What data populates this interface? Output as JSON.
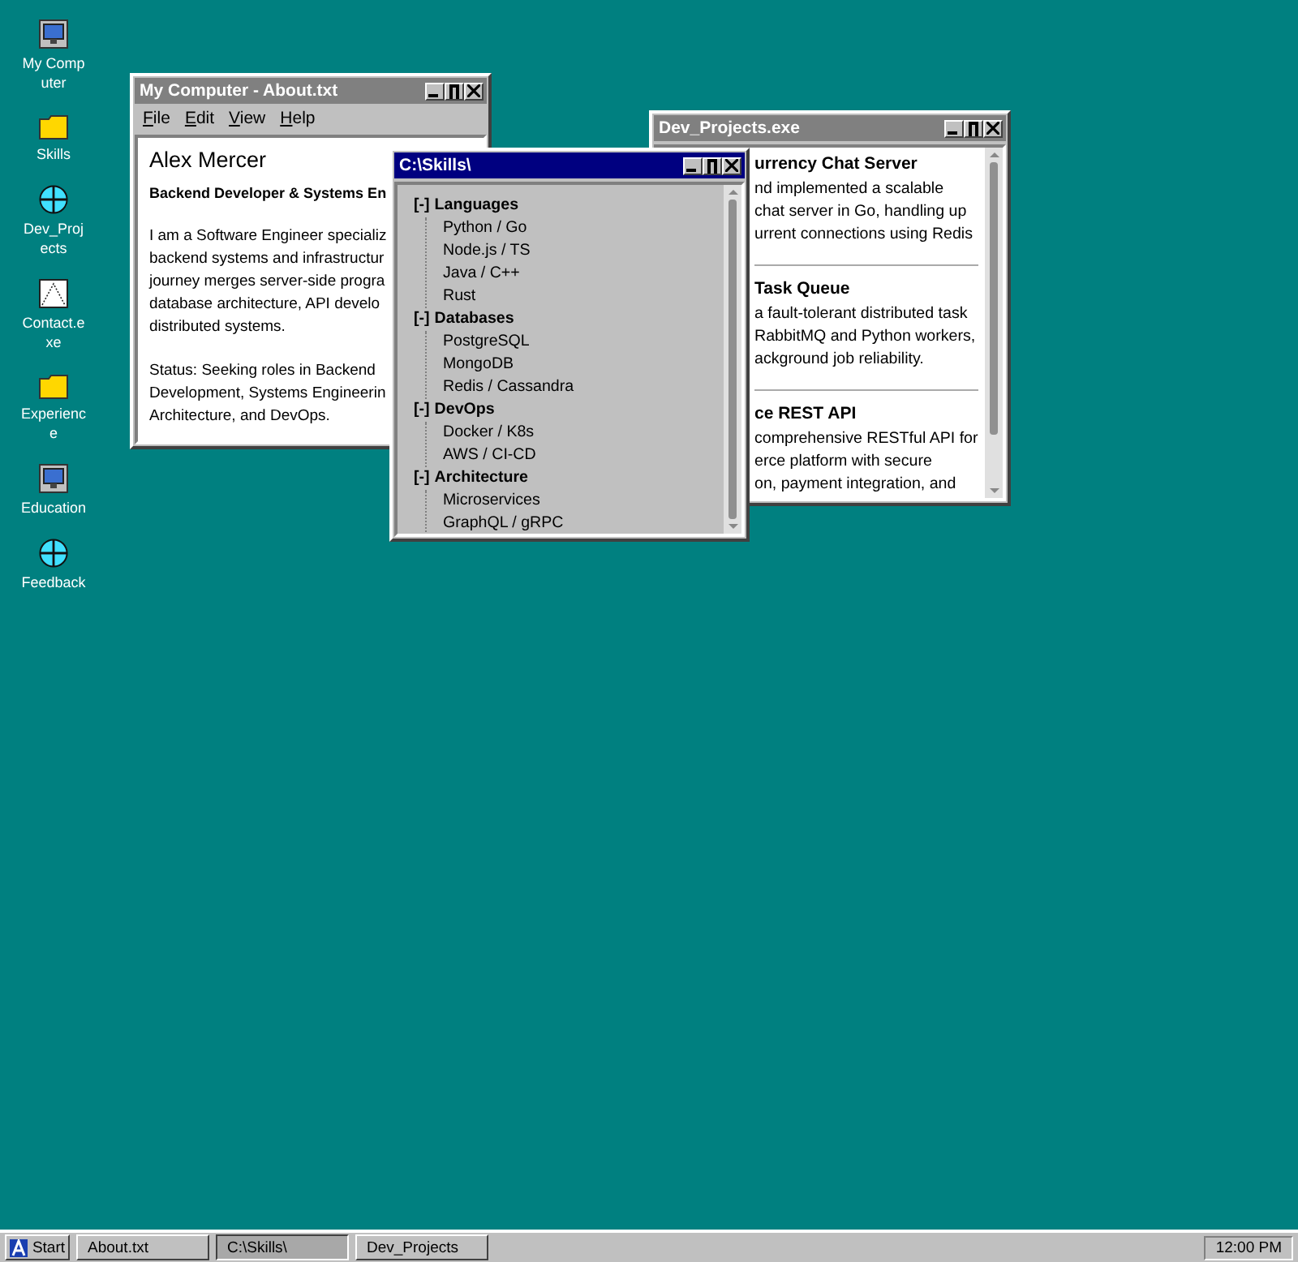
{
  "desktop_icons": [
    {
      "label": "My Computer",
      "kind": "computer"
    },
    {
      "label": "Skills",
      "kind": "folder"
    },
    {
      "label": "Dev_Projects",
      "kind": "globe"
    },
    {
      "label": "Contact.exe",
      "kind": "document"
    },
    {
      "label": "Experience",
      "kind": "folder"
    },
    {
      "label": "Education",
      "kind": "computer"
    },
    {
      "label": "Feedback",
      "kind": "globe"
    }
  ],
  "about_window": {
    "title": "My Computer - About.txt",
    "active": false,
    "menu": [
      "File",
      "Edit",
      "View",
      "Help"
    ],
    "name": "Alex Mercer",
    "subtitle": "Backend Developer & Systems En",
    "paragraphs": [
      [
        "I am a Software Engineer specializ",
        "backend systems and infrastructur",
        "journey merges server-side progra",
        "database architecture, API develo",
        "distributed systems."
      ],
      [
        "Status: Seeking roles in Backend",
        "Development, Systems Engineerin",
        "Architecture, and DevOps."
      ]
    ]
  },
  "projects_window": {
    "title": "Dev_Projects.exe",
    "active": false,
    "projects": [
      {
        "title": "urrency Chat Server",
        "lines": [
          "nd implemented a scalable",
          "chat server in Go, handling up",
          "urrent connections using Redis"
        ]
      },
      {
        "title": "Task Queue",
        "lines": [
          "a fault-tolerant distributed task",
          "RabbitMQ and Python workers,",
          "ackground job reliability."
        ]
      },
      {
        "title": "ce REST API",
        "lines": [
          "comprehensive RESTful API for",
          "erce platform with secure",
          "on, payment integration, and"
        ]
      }
    ]
  },
  "skills_window": {
    "title": "C:\\Skills\\",
    "active": true,
    "groups": [
      {
        "toggle": "[-]",
        "label": "Languages",
        "children": [
          {
            "label": "Python / Go"
          },
          {
            "label": "Node.js / TS"
          },
          {
            "label": "Java / C++"
          },
          {
            "label": "Rust"
          }
        ]
      },
      {
        "toggle": "[-]",
        "label": "Databases",
        "children": [
          {
            "label": "PostgreSQL"
          },
          {
            "label": "MongoDB"
          },
          {
            "label": "Redis / Cassandra"
          }
        ]
      },
      {
        "toggle": "[-]",
        "label": "DevOps",
        "children": [
          {
            "label": "Docker / K8s"
          },
          {
            "label": "AWS / CI-CD"
          }
        ]
      },
      {
        "toggle": "[-]",
        "label": "Architecture",
        "children": [
          {
            "label": "Microservices"
          },
          {
            "label": "GraphQL / gRPC"
          }
        ]
      }
    ]
  },
  "taskbar": {
    "start": "Start",
    "buttons": [
      {
        "label": "About.txt",
        "selected": false
      },
      {
        "label": "C:\\Skills\\",
        "selected": true
      },
      {
        "label": "Dev_Projects",
        "selected": false
      }
    ],
    "clock": "12:00 PM"
  }
}
